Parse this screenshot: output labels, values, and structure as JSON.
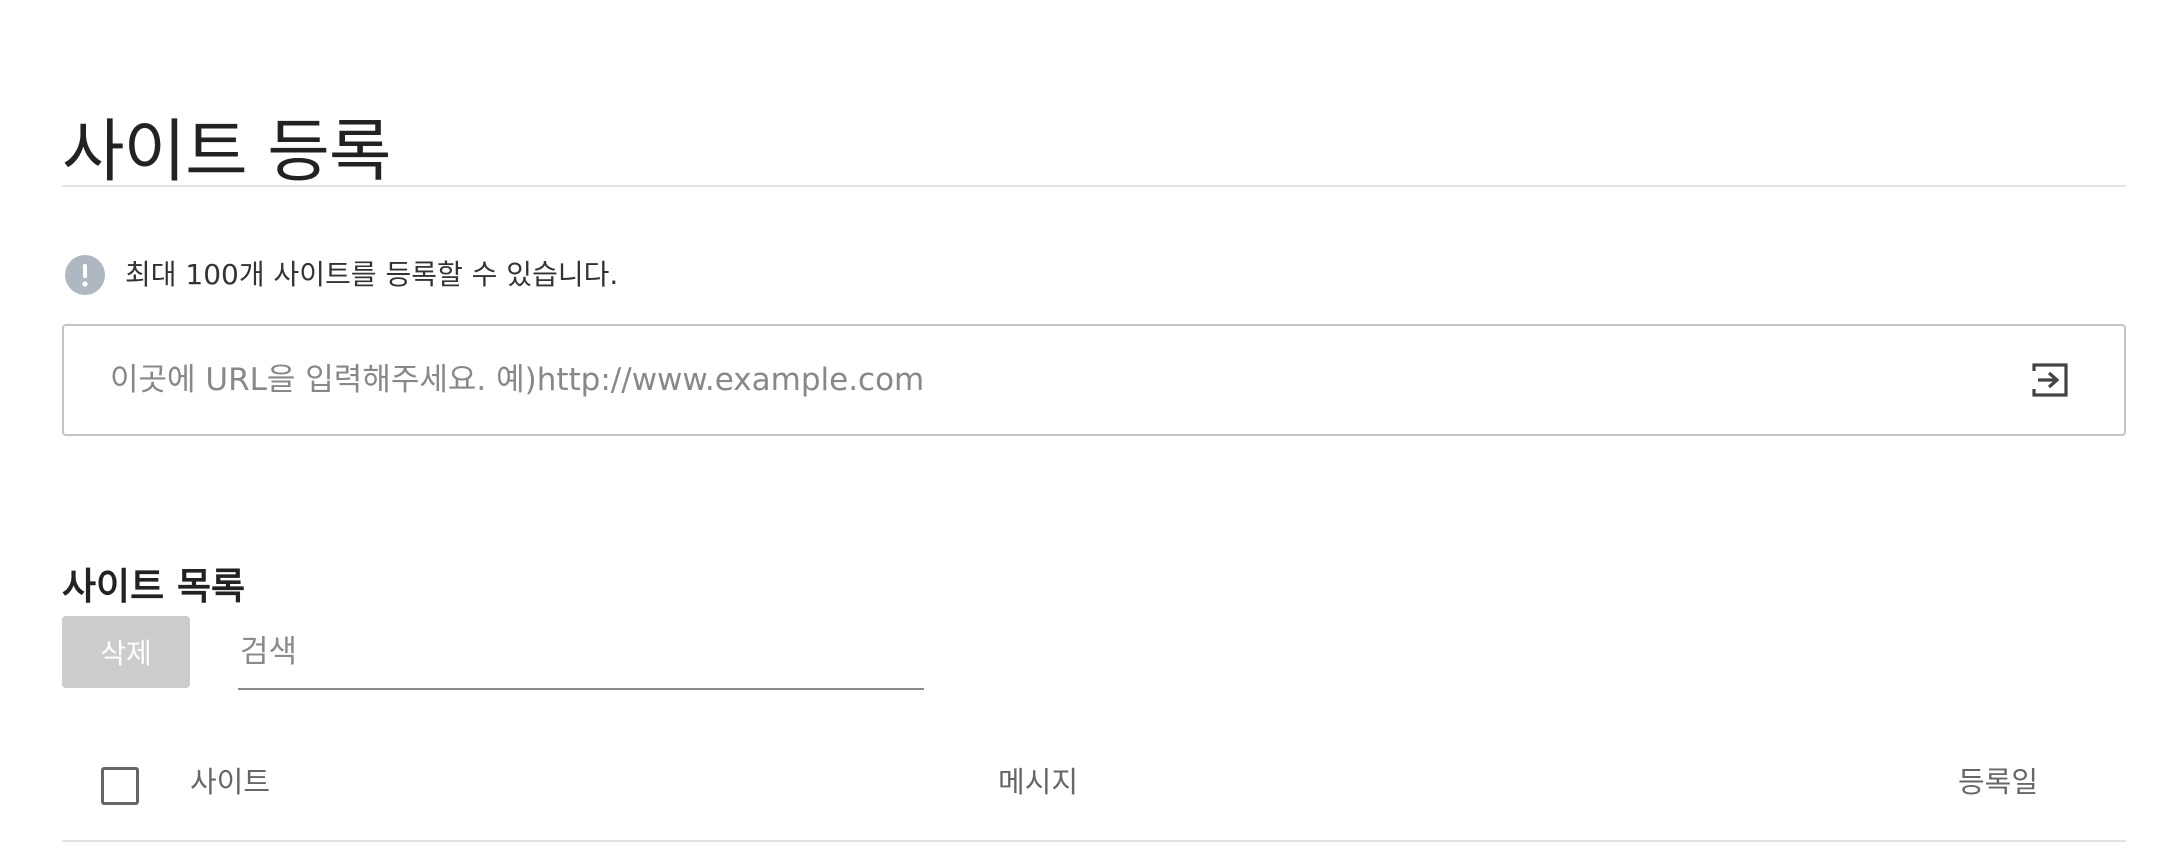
{
  "header": {
    "title": "사이트 등록"
  },
  "notice": {
    "icon": "exclamation-icon",
    "icon_color": "#adb8c2",
    "text": "최대 100개 사이트를 등록할 수 있습니다."
  },
  "url_form": {
    "placeholder": "이곳에 URL을 입력해주세요. 예)http://www.example.com",
    "value": "",
    "submit_icon": "enter-arrow-icon"
  },
  "site_list": {
    "title": "사이트 목록",
    "delete_label": "삭제",
    "delete_enabled": false,
    "search_placeholder": "검색",
    "columns": {
      "site": "사이트",
      "message": "메시지",
      "date": "등록일"
    },
    "select_all_checked": false
  }
}
